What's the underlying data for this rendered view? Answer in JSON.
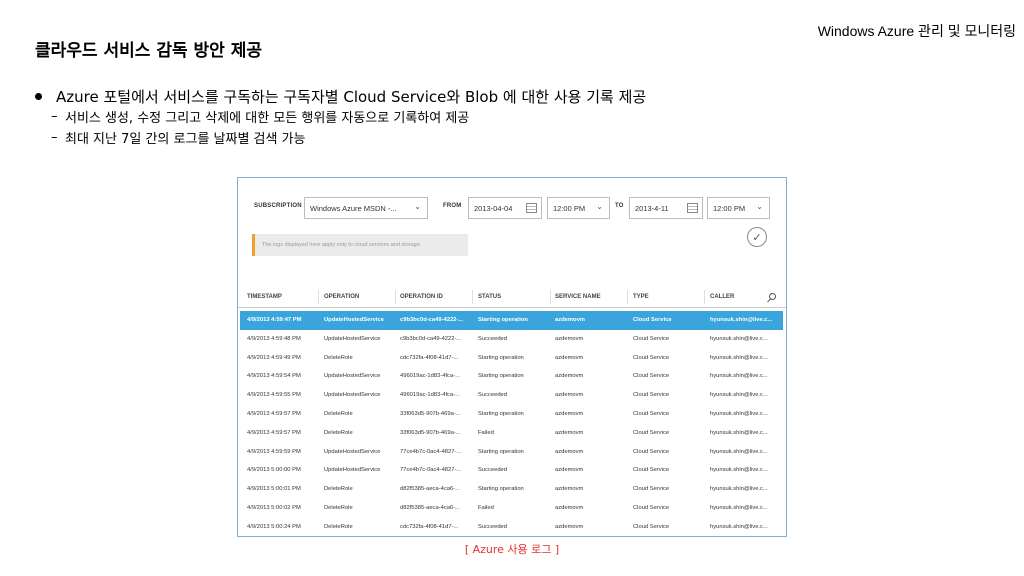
{
  "header_note": "Windows Azure 관리 및 모니터링",
  "title": "클라우드 서비스 감독 방안 제공",
  "bullet_main": "Azure 포털에서 서비스를 구독하는 구독자별 Cloud Service와 Blob 에 대한 사용 기록 제공",
  "sub_bullets": [
    {
      "dash": "–",
      "text": "서비스 생성, 수정 그리고 삭제에 대한 모든 행위를 자동으로 기록하여 제공"
    },
    {
      "dash": "–",
      "text": "최대 지난 7일 간의 로그를 날짜별 검색 가능"
    }
  ],
  "filters": {
    "subscription_label": "SUBSCRIPTION",
    "subscription_value": "Windows Azure MSDN -...",
    "from_label": "FROM",
    "from_date": "2013-04-04",
    "from_time": "12:00 PM",
    "to_label": "TO",
    "to_date": "2013-4-11",
    "to_time": "12:00 PM",
    "chevron": "⌄",
    "check": "✓"
  },
  "notice": "The logs displayed here apply only to cloud services and storage.",
  "columns": [
    "TIMESTAMP",
    "OPERATION",
    "OPERATION ID",
    "STATUS",
    "SERVICE NAME",
    "TYPE",
    "CALLER"
  ],
  "rows": [
    [
      "4/9/2013 4:59:47 PM",
      "UpdateHostedService",
      "c9b3bc0d-ca49-4222-...",
      "Starting operation",
      "azdemovm",
      "Cloud Service",
      "hyunsuk.shin@live.c..."
    ],
    [
      "4/9/2013 4:59:48 PM",
      "UpdateHostedService",
      "c9b3bc0d-ca49-4222-...",
      "Succeeded",
      "azdemovm",
      "Cloud Service",
      "hyunsuk.shin@live.c..."
    ],
    [
      "4/9/2013 4:59:49 PM",
      "DeleteRole",
      "cdc732fa-4f08-41d7-...",
      "Starting operation",
      "azdemovm",
      "Cloud Service",
      "hyunsuk.shin@live.c..."
    ],
    [
      "4/9/2013 4:59:54 PM",
      "UpdateHostedService",
      "496019ac-1d83-4fca-...",
      "Starting operation",
      "azdemovm",
      "Cloud Service",
      "hyunsuk.shin@live.c..."
    ],
    [
      "4/9/2013 4:59:55 PM",
      "UpdateHostedService",
      "496019ac-1d83-4fca-...",
      "Succeeded",
      "azdemovm",
      "Cloud Service",
      "hyunsuk.shin@live.c..."
    ],
    [
      "4/9/2013 4:59:57 PM",
      "DeleteRole",
      "33f063d5-907b-469a-...",
      "Starting operation",
      "azdemovm",
      "Cloud Service",
      "hyunsuk.shin@live.c..."
    ],
    [
      "4/9/2013 4:59:57 PM",
      "DeleteRole",
      "33f063d5-907b-469a-...",
      "Failed",
      "azdemovm",
      "Cloud Service",
      "hyunsuk.shin@live.c..."
    ],
    [
      "4/9/2013 4:59:59 PM",
      "UpdateHostedService",
      "77ce4b7c-0ac4-4827-...",
      "Starting operation",
      "azdemovm",
      "Cloud Service",
      "hyunsuk.shin@live.c..."
    ],
    [
      "4/9/2013 5:00:00 PM",
      "UpdateHostedService",
      "77ce4b7c-0ac4-4827-...",
      "Succeeded",
      "azdemovm",
      "Cloud Service",
      "hyunsuk.shin@live.c..."
    ],
    [
      "4/9/2013 5:00:01 PM",
      "DeleteRole",
      "d82f5385-aeca-4ca6-...",
      "Starting operation",
      "azdemovm",
      "Cloud Service",
      "hyunsuk.shin@live.c..."
    ],
    [
      "4/9/2013 5:00:02 PM",
      "DeleteRole",
      "d82f5385-aeca-4ca6-...",
      "Failed",
      "azdemovm",
      "Cloud Service",
      "hyunsuk.shin@live.c..."
    ],
    [
      "4/9/2013 5:00:24 PM",
      "DeleteRole",
      "cdc732fa-4f08-41d7-...",
      "Succeeded",
      "azdemovm",
      "Cloud Service",
      "hyunsuk.shin@live.c..."
    ]
  ],
  "selected_row": 0,
  "caption": "[ Azure 사용 로그 ]",
  "colors": {
    "accent": "#3aa5dc",
    "notice_border": "#f0a030",
    "caption": "#e03030"
  },
  "icons": [
    "chevron-down-icon",
    "calendar-icon",
    "check-circle-icon",
    "search-icon"
  ]
}
